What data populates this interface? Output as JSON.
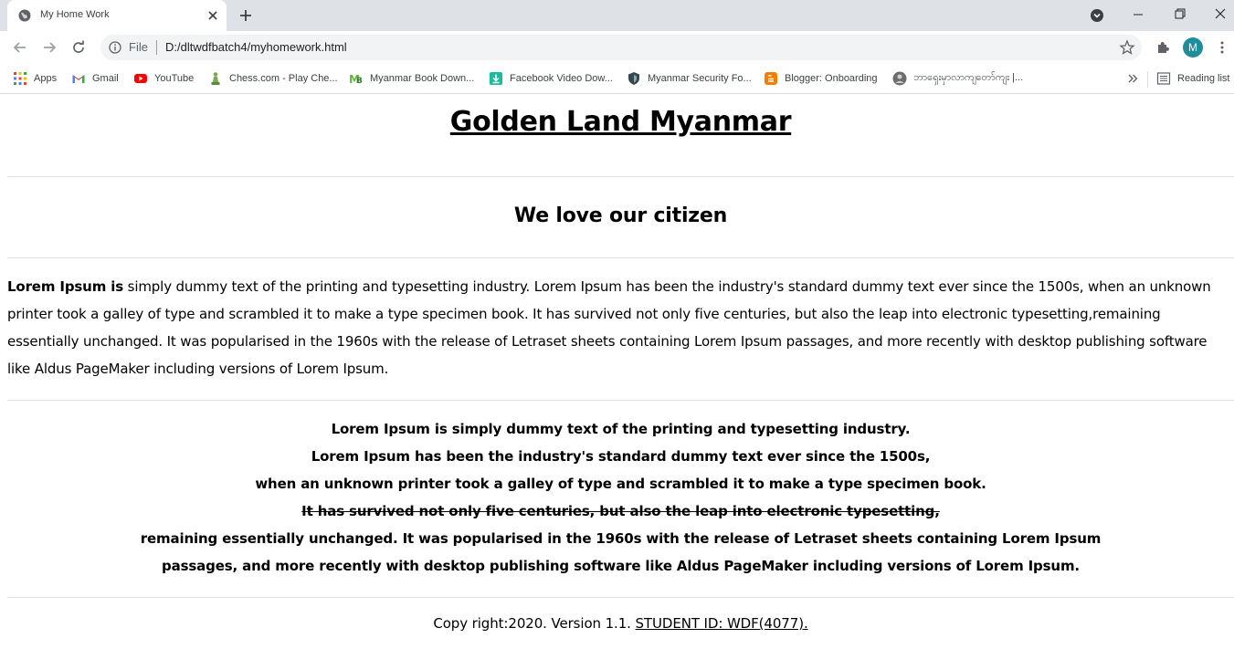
{
  "browser": {
    "tab_title": "My Home Work",
    "url_scheme": "File",
    "url": "D:/dltwdfbatch4/myhomework.html",
    "profile_initial": "M",
    "profile_color": "#1e8e9a"
  },
  "bookmarks": [
    {
      "label": "Apps",
      "icon": "apps-grid-icon"
    },
    {
      "label": "Gmail",
      "icon": "gmail-icon"
    },
    {
      "label": "YouTube",
      "icon": "youtube-icon"
    },
    {
      "label": "Chess.com - Play Che...",
      "icon": "chess-icon"
    },
    {
      "label": "Myanmar Book Down...",
      "icon": "mb-icon"
    },
    {
      "label": "Facebook Video Dow...",
      "icon": "download-icon"
    },
    {
      "label": "Myanmar Security Fo...",
      "icon": "shield-icon"
    },
    {
      "label": "Blogger: Onboarding",
      "icon": "blogger-icon"
    },
    {
      "label": "ဘာရှေးမှာလာကျတော်ကျး |...",
      "icon": "avatar-icon"
    }
  ],
  "reading_list": "Reading list",
  "page": {
    "heading": "Golden Land Myanmar",
    "subheading": "We love our citizen",
    "para_bold": "Lorem Ipsum is",
    "para_text": " simply dummy text of the printing and typesetting industry. Lorem Ipsum has been the industry's standard dummy text ever since the 1500s, when an unknown printer took a galley of type and scrambled it to make a type specimen book. It has survived not only five centuries, but also the leap into electronic typesetting,remaining essentially unchanged. It was popularised in the 1960s with the release of Letraset sheets containing Lorem Ipsum passages, and more recently with desktop publishing software like Aldus PageMaker including versions of Lorem Ipsum.",
    "center_lines": [
      "Lorem Ipsum is simply dummy text of the printing and typesetting industry.",
      "Lorem Ipsum has been the industry's standard dummy text ever since the 1500s,",
      "when an unknown printer took a galley of type and scrambled it to make a type specimen book.",
      "It has survived not only five centuries, but also the leap into electronic typesetting,",
      "remaining essentially unchanged. It was popularised in the 1960s with the release of Letraset sheets containing Lorem Ipsum",
      "passages, and more recently with desktop publishing software like Aldus PageMaker including versions of Lorem Ipsum."
    ],
    "footer_text": "Copy right:2020. Version 1.1. ",
    "footer_link": "STUDENT ID: WDF(4077)."
  }
}
